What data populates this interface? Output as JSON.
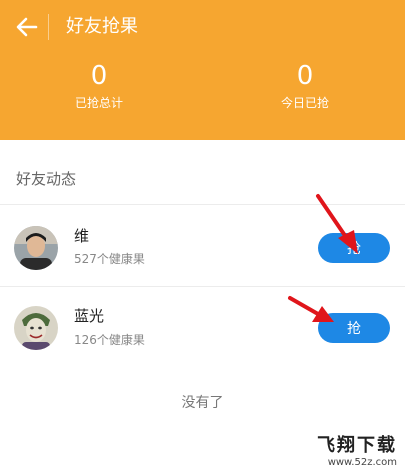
{
  "header": {
    "title": "好友抢果",
    "stats": [
      {
        "value": "0",
        "label": "已抢总计"
      },
      {
        "value": "0",
        "label": "今日已抢"
      }
    ],
    "color": "#f6a630"
  },
  "feed": {
    "section_title": "好友动态",
    "friends": [
      {
        "name": "维",
        "fruits": "527个健康果",
        "action": "抢"
      },
      {
        "name": "蓝光",
        "fruits": "126个健康果",
        "action": "抢"
      }
    ],
    "end_text": "没有了",
    "button_color": "#1e88e5"
  },
  "annotations": {
    "arrow_color": "#e0151b"
  },
  "watermark": {
    "brand": "飞翔下载",
    "site": "www.52z.com"
  }
}
